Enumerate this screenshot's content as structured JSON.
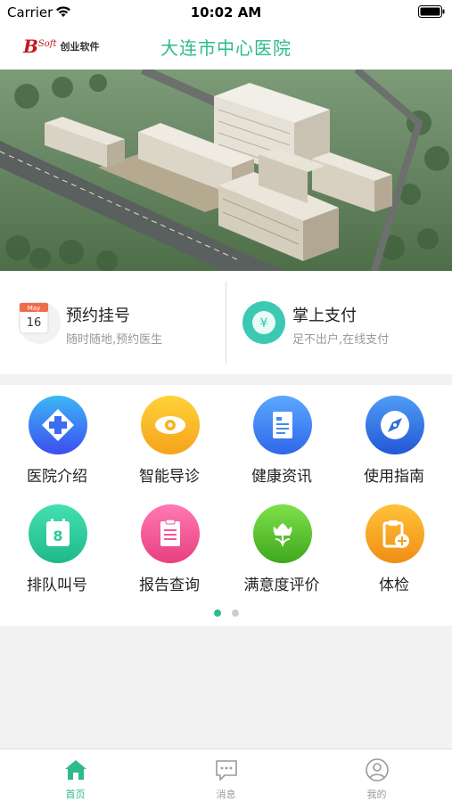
{
  "status_bar": {
    "carrier": "Carrier",
    "time": "10:02 AM"
  },
  "header": {
    "logo_mark": "B",
    "logo_mark_small": "Soft",
    "logo_text": "创业软件",
    "title": "大连市中心医院"
  },
  "quick_actions": [
    {
      "title": "预约挂号",
      "subtitle": "随时随地,预约医生",
      "icon": "calendar-icon",
      "calendar_month": "May",
      "calendar_day": "16"
    },
    {
      "title": "掌上支付",
      "subtitle": "足不出户,在线支付",
      "icon": "yen-coin-icon"
    }
  ],
  "grid": [
    {
      "label": "医院介绍",
      "icon": "cross-icon",
      "color": "#3d6cf0"
    },
    {
      "label": "智能导诊",
      "icon": "eye-icon",
      "color": "#f5b51c"
    },
    {
      "label": "健康资讯",
      "icon": "document-icon",
      "color": "#3d8cf5"
    },
    {
      "label": "使用指南",
      "icon": "compass-icon",
      "color": "#2f6fe0"
    },
    {
      "label": "排队叫号",
      "icon": "queue-number-icon",
      "color": "#2dcc9a",
      "number": "8"
    },
    {
      "label": "报告查询",
      "icon": "report-icon",
      "color": "#f2559a"
    },
    {
      "label": "满意度评价",
      "icon": "flower-icon",
      "color": "#57c22b"
    },
    {
      "label": "体检",
      "icon": "clipboard-plus-icon",
      "color": "#f5a31c"
    }
  ],
  "pagination": {
    "pages": 2,
    "current": 1
  },
  "tabbar": [
    {
      "label": "首页",
      "icon": "home-icon",
      "active": true
    },
    {
      "label": "消息",
      "icon": "message-icon",
      "active": false
    },
    {
      "label": "我的",
      "icon": "profile-icon",
      "active": false
    }
  ],
  "colors": {
    "accent": "#2dbb89",
    "background": "#f2f2f2"
  }
}
